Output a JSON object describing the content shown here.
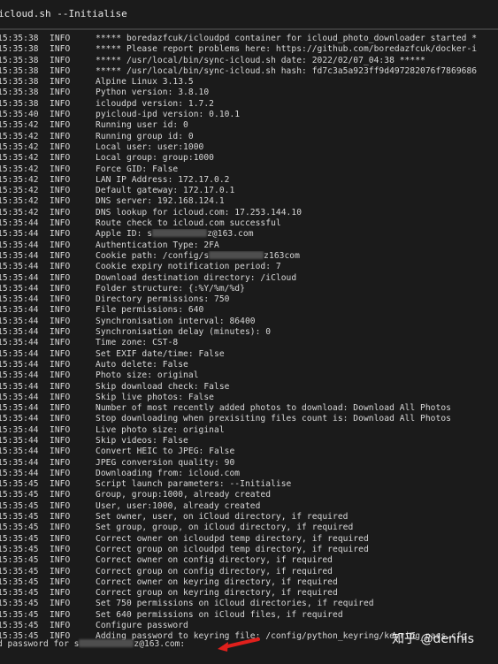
{
  "window": {
    "title": "icloud.sh --Initialise"
  },
  "log": [
    {
      "time": "15:35:38",
      "level": "INFO",
      "pre": "***** boredazfcuk/icloudpd container for icloud_photo_downloader started *"
    },
    {
      "time": "15:35:38",
      "level": "INFO",
      "pre": "***** Please report problems here: https://github.com/boredazfcuk/docker-i"
    },
    {
      "time": "15:35:38",
      "level": "INFO",
      "pre": "***** /usr/local/bin/sync-icloud.sh date: 2022/02/07_04:38 *****"
    },
    {
      "time": "15:35:38",
      "level": "INFO",
      "pre": "***** /usr/local/bin/sync-icloud.sh hash: fd7c3a5a923ff9d497282076f7869686"
    },
    {
      "time": "15:35:38",
      "level": "INFO",
      "pre": "Alpine Linux 3.13.5"
    },
    {
      "time": "15:35:38",
      "level": "INFO",
      "pre": "Python version: 3.8.10"
    },
    {
      "time": "15:35:38",
      "level": "INFO",
      "pre": "icloudpd version: 1.7.2"
    },
    {
      "time": "15:35:40",
      "level": "INFO",
      "pre": "pyicloud-ipd version: 0.10.1"
    },
    {
      "time": "15:35:42",
      "level": "INFO",
      "pre": "Running user id: 0"
    },
    {
      "time": "15:35:42",
      "level": "INFO",
      "pre": "Running group id: 0"
    },
    {
      "time": "15:35:42",
      "level": "INFO",
      "pre": "Local user: user:1000"
    },
    {
      "time": "15:35:42",
      "level": "INFO",
      "pre": "Local group: group:1000"
    },
    {
      "time": "15:35:42",
      "level": "INFO",
      "pre": "Force GID: False"
    },
    {
      "time": "15:35:42",
      "level": "INFO",
      "pre": "LAN IP Address: 172.17.0.2"
    },
    {
      "time": "15:35:42",
      "level": "INFO",
      "pre": "Default gateway: 172.17.0.1"
    },
    {
      "time": "15:35:42",
      "level": "INFO",
      "pre": "DNS server: 192.168.124.1"
    },
    {
      "time": "15:35:42",
      "level": "INFO",
      "pre": "DNS lookup for icloud.com: 17.253.144.10"
    },
    {
      "time": "15:35:44",
      "level": "INFO",
      "pre": "Route check to icloud.com successful"
    },
    {
      "time": "15:35:44",
      "level": "INFO",
      "pre": "Apple ID: s",
      "post": "z@163.com"
    },
    {
      "time": "15:35:44",
      "level": "INFO",
      "pre": "Authentication Type: 2FA"
    },
    {
      "time": "15:35:44",
      "level": "INFO",
      "pre": "Cookie path: /config/s",
      "post": "z163com"
    },
    {
      "time": "15:35:44",
      "level": "INFO",
      "pre": "Cookie expiry notification period: 7"
    },
    {
      "time": "15:35:44",
      "level": "INFO",
      "pre": "Download destination directory: /iCloud"
    },
    {
      "time": "15:35:44",
      "level": "INFO",
      "pre": "Folder structure: {:%Y/%m/%d}"
    },
    {
      "time": "15:35:44",
      "level": "INFO",
      "pre": "Directory permissions: 750"
    },
    {
      "time": "15:35:44",
      "level": "INFO",
      "pre": "File permissions: 640"
    },
    {
      "time": "15:35:44",
      "level": "INFO",
      "pre": "Synchronisation interval: 86400"
    },
    {
      "time": "15:35:44",
      "level": "INFO",
      "pre": "Synchronisation delay (minutes): 0"
    },
    {
      "time": "15:35:44",
      "level": "INFO",
      "pre": "Time zone: CST-8"
    },
    {
      "time": "15:35:44",
      "level": "INFO",
      "pre": "Set EXIF date/time: False"
    },
    {
      "time": "15:35:44",
      "level": "INFO",
      "pre": "Auto delete: False"
    },
    {
      "time": "15:35:44",
      "level": "INFO",
      "pre": "Photo size: original"
    },
    {
      "time": "15:35:44",
      "level": "INFO",
      "pre": "Skip download check: False"
    },
    {
      "time": "15:35:44",
      "level": "INFO",
      "pre": "Skip live photos: False"
    },
    {
      "time": "15:35:44",
      "level": "INFO",
      "pre": "Number of most recently added photos to download: Download All Photos"
    },
    {
      "time": "15:35:44",
      "level": "INFO",
      "pre": "Stop downloading when prexisiting files count is: Download All Photos"
    },
    {
      "time": "15:35:44",
      "level": "INFO",
      "pre": "Live photo size: original"
    },
    {
      "time": "15:35:44",
      "level": "INFO",
      "pre": "Skip videos: False"
    },
    {
      "time": "15:35:44",
      "level": "INFO",
      "pre": "Convert HEIC to JPEG: False"
    },
    {
      "time": "15:35:44",
      "level": "INFO",
      "pre": "JPEG conversion quality: 90"
    },
    {
      "time": "15:35:44",
      "level": "INFO",
      "pre": "Downloading from: icloud.com"
    },
    {
      "time": "15:35:45",
      "level": "INFO",
      "pre": "Script launch parameters: --Initialise"
    },
    {
      "time": "15:35:45",
      "level": "INFO",
      "pre": "Group, group:1000, already created"
    },
    {
      "time": "15:35:45",
      "level": "INFO",
      "pre": "User, user:1000, already created"
    },
    {
      "time": "15:35:45",
      "level": "INFO",
      "pre": "Set owner, user, on iCloud directory, if required"
    },
    {
      "time": "15:35:45",
      "level": "INFO",
      "pre": "Set group, group, on iCloud directory, if required"
    },
    {
      "time": "15:35:45",
      "level": "INFO",
      "pre": "Correct owner on icloudpd temp directory, if required"
    },
    {
      "time": "15:35:45",
      "level": "INFO",
      "pre": "Correct group on icloudpd temp directory, if required"
    },
    {
      "time": "15:35:45",
      "level": "INFO",
      "pre": "Correct owner on config directory, if required"
    },
    {
      "time": "15:35:45",
      "level": "INFO",
      "pre": "Correct group on config directory, if required"
    },
    {
      "time": "15:35:45",
      "level": "INFO",
      "pre": "Correct owner on keyring directory, if required"
    },
    {
      "time": "15:35:45",
      "level": "INFO",
      "pre": "Correct group on keyring directory, if required"
    },
    {
      "time": "15:35:45",
      "level": "INFO",
      "pre": "Set 750 permissions on iCloud directories, if required"
    },
    {
      "time": "15:35:45",
      "level": "INFO",
      "pre": "Set 640 permissions on iCloud files, if required"
    },
    {
      "time": "15:35:45",
      "level": "INFO",
      "pre": "Configure password"
    },
    {
      "time": "15:35:45",
      "level": "INFO",
      "pre": "Adding password to keyring file: /config/python_keyring/keyring_pass.cfg"
    }
  ],
  "prompt": {
    "pre": "d password for s",
    "post": "z@163.com:"
  },
  "watermark": {
    "text": "知乎 @dennis"
  },
  "colors": {
    "background": "#1b1b1b",
    "text": "#d8d8d8",
    "arrow": "#e0201c"
  }
}
